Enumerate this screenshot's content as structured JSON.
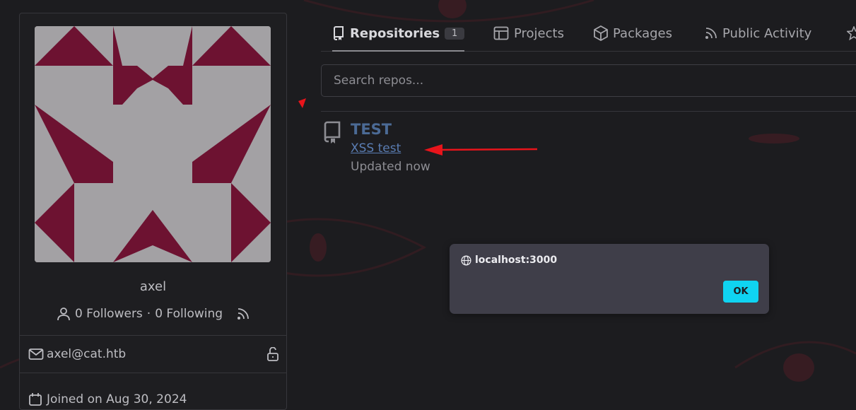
{
  "profile": {
    "username": "axel",
    "followers": "0 Followers",
    "separator": "·",
    "following": "0 Following",
    "email": "axel@cat.htb",
    "joined_text": "Joined on Aug 30, 2024"
  },
  "tabs": [
    {
      "label": "Repositories",
      "count": "1",
      "icon": "repo-icon",
      "active": true
    },
    {
      "label": "Projects",
      "icon": "project-icon"
    },
    {
      "label": "Packages",
      "icon": "package-icon"
    },
    {
      "label": "Public Activity",
      "icon": "rss-icon"
    }
  ],
  "search": {
    "placeholder": "Search repos..."
  },
  "repos": [
    {
      "name": "TEST",
      "description": "XSS test",
      "updated": "Updated now"
    }
  ],
  "alert": {
    "origin": "localhost:3000",
    "ok_label": "OK",
    "origin_icon": "globe-icon"
  },
  "colors": {
    "background": "#1c1c1f",
    "identicon_fg": "#6d1231",
    "identicon_bg": "#a3a1a4",
    "link": "#5a7db3",
    "ok_button": "#0fd3f1",
    "annotation_arrow": "#e8141b"
  }
}
